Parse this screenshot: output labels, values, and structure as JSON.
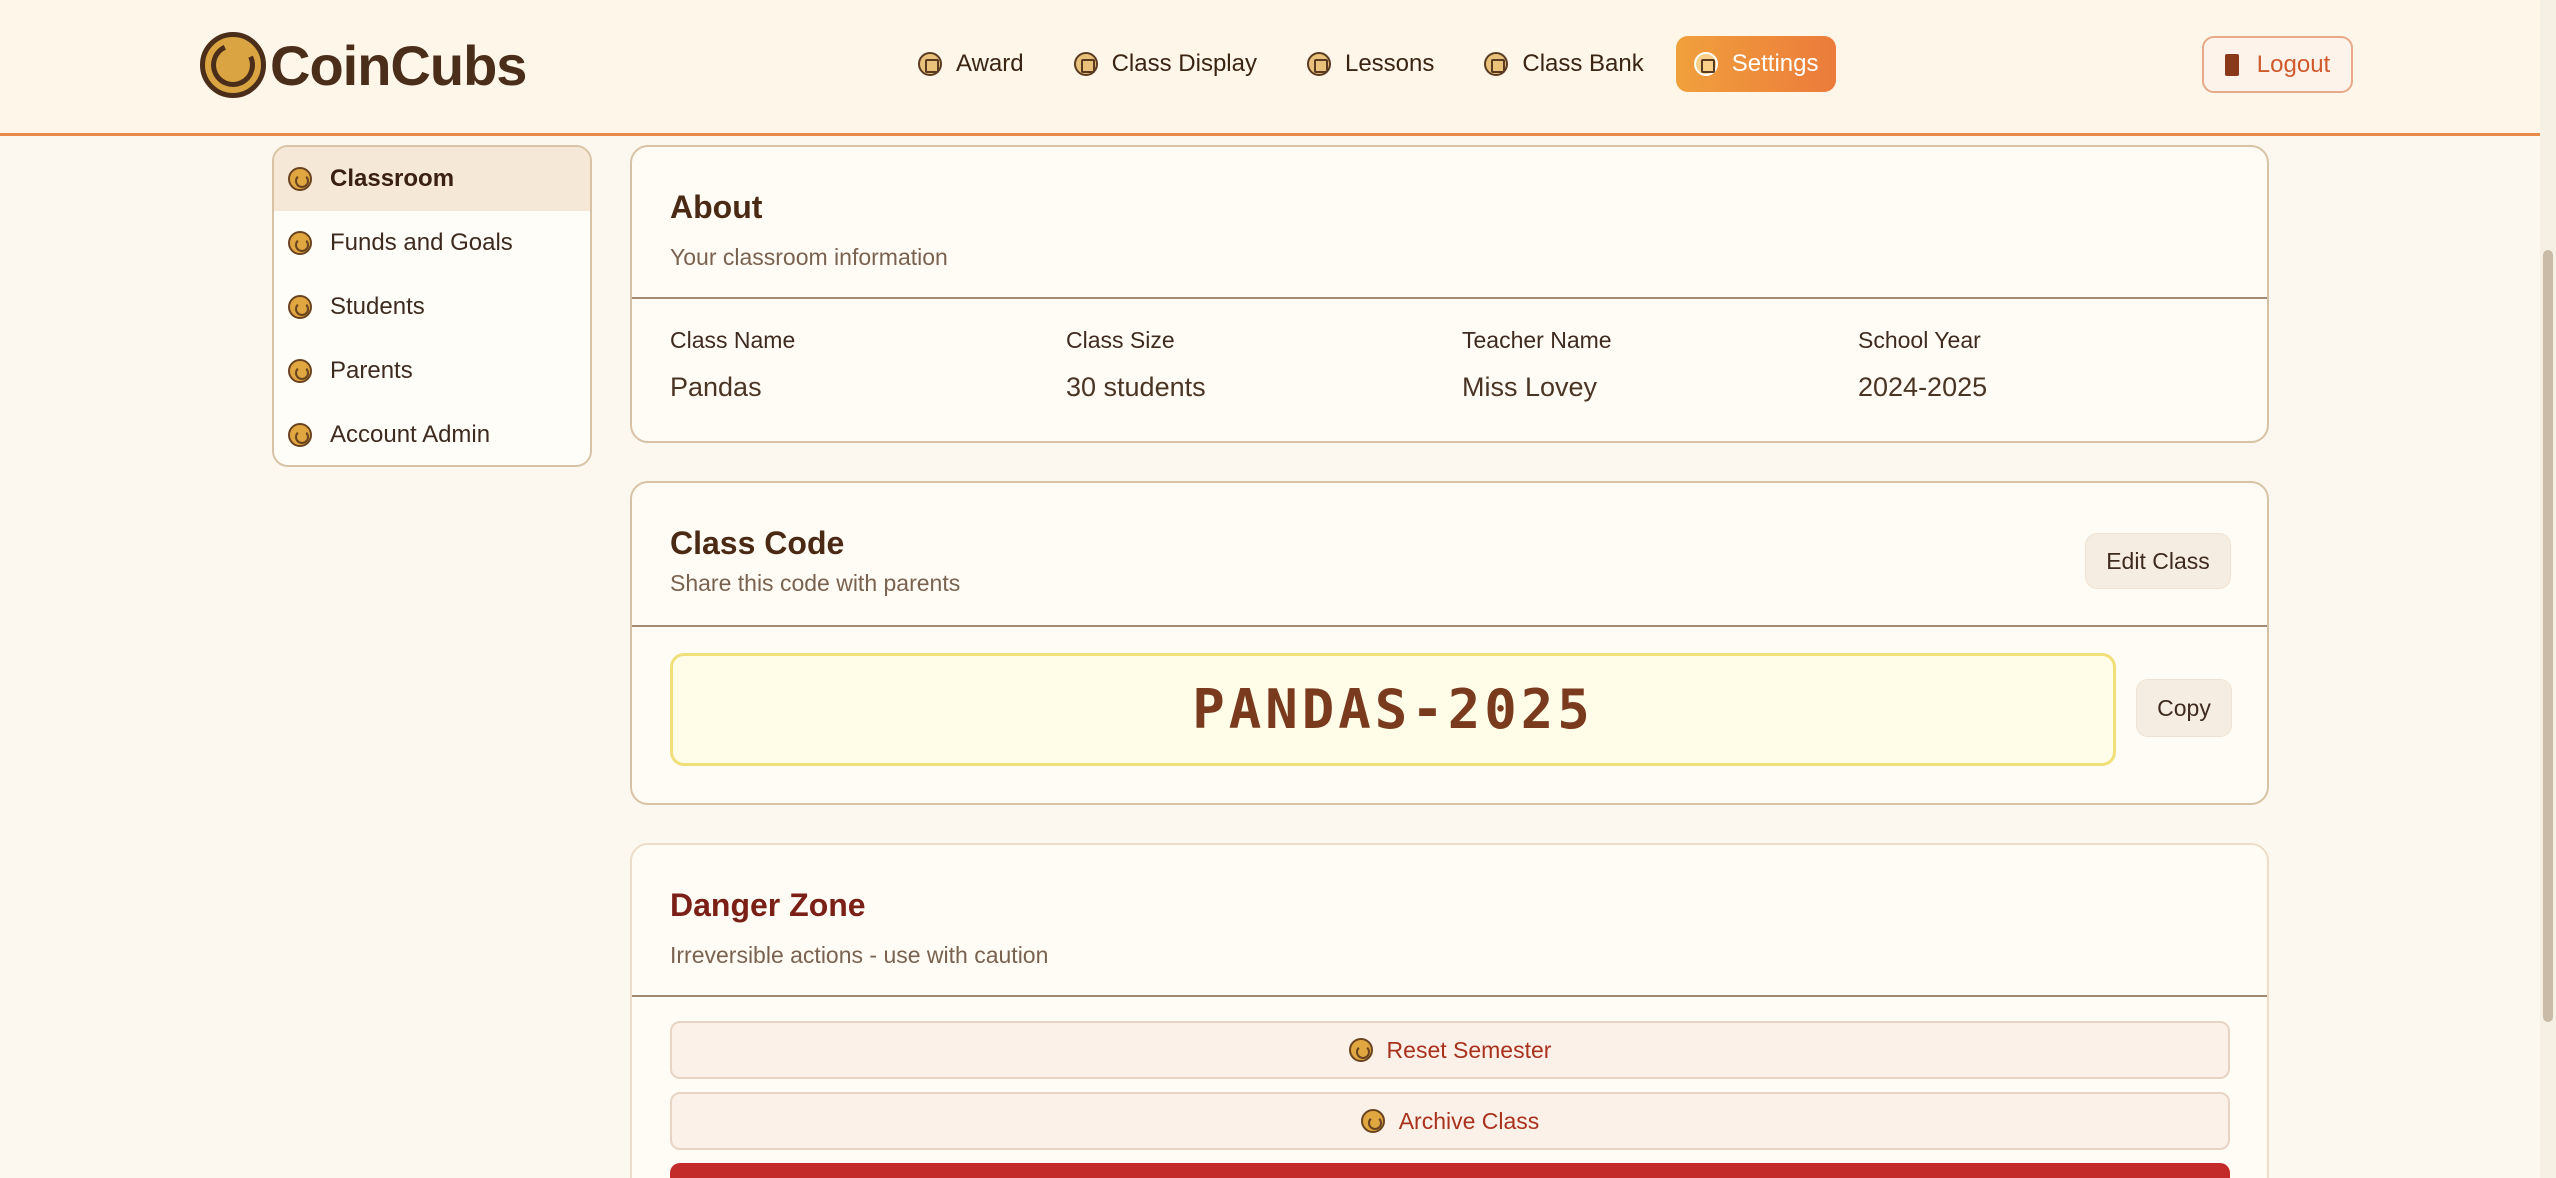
{
  "brand": {
    "name": "CoinCubs"
  },
  "nav": [
    {
      "label": "Award",
      "icon": "trophy-icon"
    },
    {
      "label": "Class Display",
      "icon": "display-icon"
    },
    {
      "label": "Lessons",
      "icon": "book-icon"
    },
    {
      "label": "Class Bank",
      "icon": "coin-icon"
    },
    {
      "label": "Settings",
      "icon": "gear-icon",
      "active": true
    }
  ],
  "logout_label": "Logout",
  "sidebar": {
    "items": [
      {
        "label": "Classroom",
        "active": true
      },
      {
        "label": "Funds and Goals"
      },
      {
        "label": "Students"
      },
      {
        "label": "Parents"
      },
      {
        "label": "Account Admin"
      }
    ]
  },
  "about": {
    "title": "About",
    "subtitle": "Your classroom information",
    "fields": [
      {
        "label": "Class Name",
        "value": "Pandas"
      },
      {
        "label": "Class Size",
        "value": "30 students"
      },
      {
        "label": "Teacher Name",
        "value": "Miss Lovey"
      },
      {
        "label": "School Year",
        "value": "2024-2025"
      }
    ]
  },
  "class_code": {
    "title": "Class Code",
    "subtitle": "Share this code with parents",
    "edit_label": "Edit Class",
    "code": "PANDAS-2025",
    "copy_label": "Copy"
  },
  "danger_zone": {
    "title": "Danger Zone",
    "subtitle": "Irreversible actions - use with caution",
    "reset_label": "Reset Semester",
    "archive_label": "Archive Class"
  },
  "colors": {
    "accent": "#ec8a3b",
    "danger": "#c32a2a",
    "background": "#fdf8ef"
  }
}
